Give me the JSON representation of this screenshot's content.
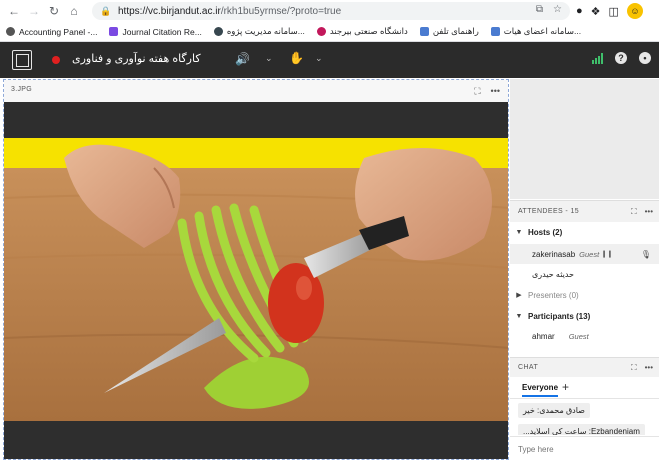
{
  "browser": {
    "url_host": "https://vc.birjandut.ac.ir",
    "url_path": "/rkh1bu5yrmse/?proto=true",
    "bookmarks": [
      {
        "label": "Accounting Panel -...",
        "color": "#555555"
      },
      {
        "label": "Journal Citation Re...",
        "color": "#7b4ae2"
      },
      {
        "label": "سامانه مدیریت پژوه...",
        "color": "#37474f"
      },
      {
        "label": "دانشگاه صنعتی بیرجند",
        "color": "#c2185b"
      },
      {
        "label": "راهنمای تلفن",
        "color": "#4a7bd0"
      },
      {
        "label": "سامانه اعضای هیات...",
        "color": "#4a7bd0"
      }
    ]
  },
  "appbar": {
    "meeting_title": "کارگاه هفته نوآوری و فناوری"
  },
  "pod": {
    "title": "3.JPG"
  },
  "attendees": {
    "header": "ATTENDEES - 15",
    "hosts_label": "Hosts (2)",
    "host1_name": "zakerinasab",
    "host1_role": "Guest",
    "host2_name": "حدیثه حیدری",
    "presenters_label": "Presenters (0)",
    "participants_label": "Participants (13)",
    "participant1_name": "ahmar",
    "participant1_role": "Guest"
  },
  "chat": {
    "header": "CHAT",
    "tab_everyone": "Everyone",
    "message1": "صادق محمدی: خیر",
    "message2": "Ezbandeniam: ساعت کی اسلاید...",
    "input_placeholder": "Type here"
  },
  "colors": {
    "appbar_bg": "#2b2b2b",
    "accent_green": "#3fbf6b",
    "record_red": "#e02020",
    "accent_blue": "#1473e6"
  }
}
